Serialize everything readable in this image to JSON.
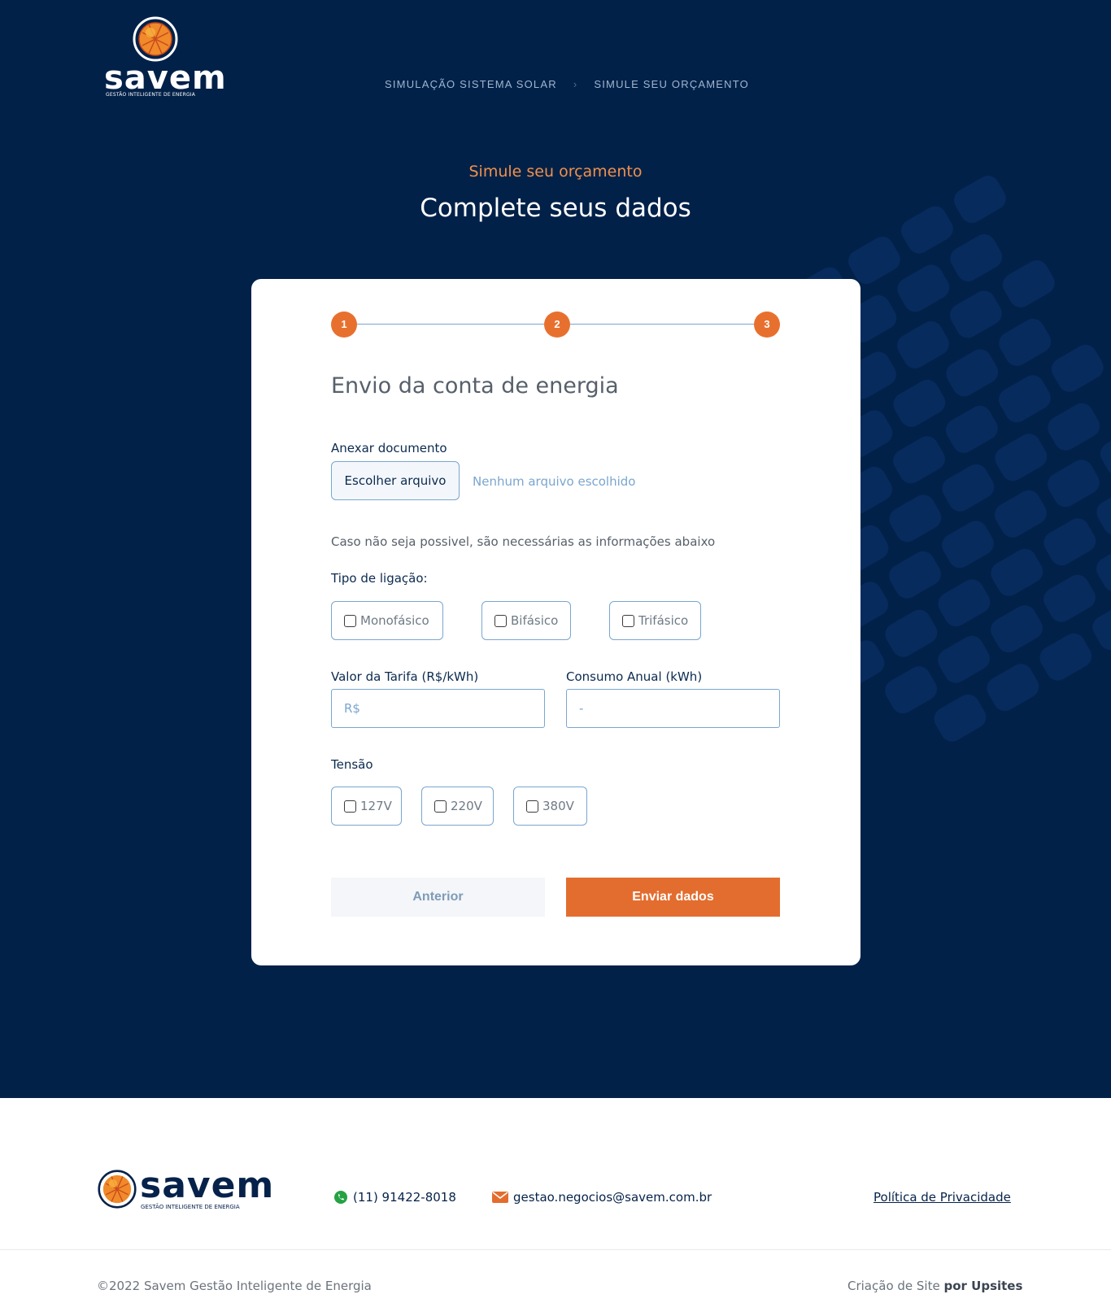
{
  "brand": {
    "name": "savem",
    "tagline": "GESTÃO INTELIGENTE DE ENERGIA"
  },
  "breadcrumb": {
    "items": [
      "SIMULAÇÃO SISTEMA SOLAR",
      "SIMULE SEU ORÇAMENTO"
    ],
    "separator": "›"
  },
  "hero": {
    "eyebrow": "Simule seu orçamento",
    "title": "Complete seus dados"
  },
  "stepper": {
    "steps": [
      "1",
      "2",
      "3"
    ]
  },
  "form": {
    "section_title": "Envio da conta de energia",
    "attach_label": "Anexar documento",
    "file_button": "Escolher arquivo",
    "file_status": "Nenhum arquivo escolhido",
    "helper_text": "Caso não seja possivel, são necessárias as informações abaixo",
    "connection_label": "Tipo de ligação:",
    "connection_options": [
      "Monofásico",
      "Bifásico",
      "Trifásico"
    ],
    "tariff_label": "Valor da Tarifa (R$/kWh)",
    "tariff_placeholder": "R$",
    "consumption_label": "Consumo Anual (kWh)",
    "consumption_placeholder": "-",
    "voltage_label": "Tensão",
    "voltage_options": [
      "127V",
      "220V",
      "380V"
    ],
    "prev_button": "Anterior",
    "submit_button": "Enviar dados"
  },
  "footer": {
    "phone": "(11) 91422-8018",
    "email": "gestao.negocios@savem.com.br",
    "privacy": "Política de Privacidade",
    "copyright": "©2022 Savem Gestão Inteligente de Energia",
    "credit_prefix": "Criação de Site",
    "credit_brand": "por Upsites"
  },
  "colors": {
    "navy": "#022149",
    "orange": "#e36d2e",
    "accent_blue": "#7aa6cf"
  },
  "icons": {
    "whatsapp": "whatsapp-icon",
    "email": "envelope-icon",
    "logo": "globe-logo-icon"
  }
}
